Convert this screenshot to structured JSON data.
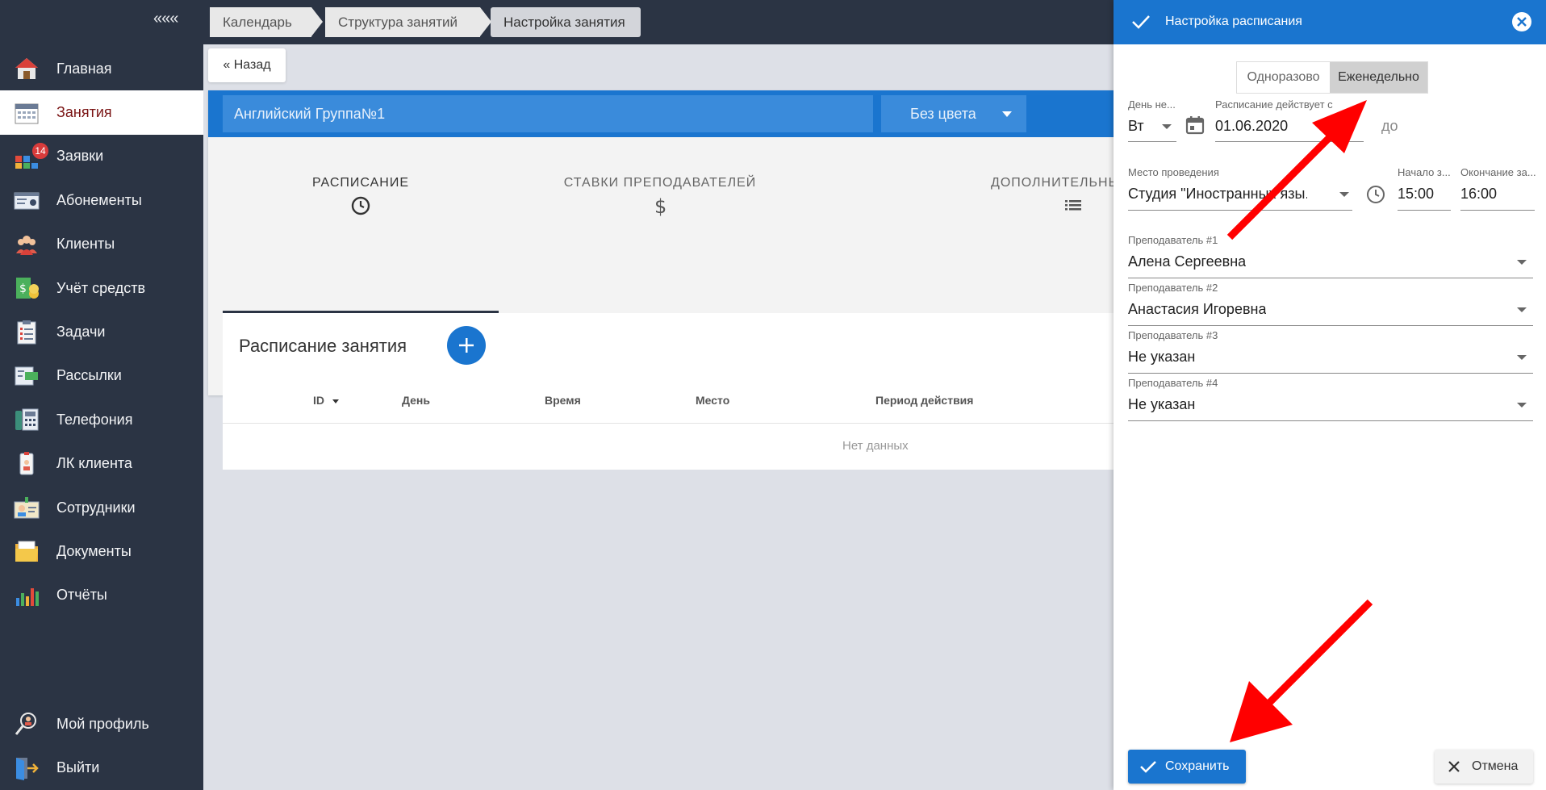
{
  "sidebar": {
    "collapse_label": "«««",
    "items": [
      {
        "label": "Главная",
        "icon": "home-icon"
      },
      {
        "label": "Занятия",
        "icon": "calendar-icon"
      },
      {
        "label": "Заявки",
        "icon": "requests-icon",
        "badge": "14"
      },
      {
        "label": "Абонементы",
        "icon": "subscription-icon"
      },
      {
        "label": "Клиенты",
        "icon": "clients-icon"
      },
      {
        "label": "Учёт средств",
        "icon": "money-icon"
      },
      {
        "label": "Задачи",
        "icon": "tasks-icon"
      },
      {
        "label": "Рассылки",
        "icon": "mailing-icon"
      },
      {
        "label": "Телефония",
        "icon": "phone-icon"
      },
      {
        "label": "ЛК клиента",
        "icon": "client-account-icon"
      },
      {
        "label": "Сотрудники",
        "icon": "staff-icon"
      },
      {
        "label": "Документы",
        "icon": "documents-icon"
      },
      {
        "label": "Отчёты",
        "icon": "reports-icon"
      }
    ],
    "bottom_items": [
      {
        "label": "Мой профиль",
        "icon": "profile-icon"
      },
      {
        "label": "Выйти",
        "icon": "logout-icon"
      }
    ]
  },
  "breadcrumbs": [
    "Календарь",
    "Структура занятий",
    "Настройка занятия"
  ],
  "main": {
    "back_label": "« Назад",
    "group_name": "Английский Группа№1",
    "color_select": "Без цвета",
    "tabs": [
      {
        "label": "РАСПИСАНИЕ",
        "icon": "clock-icon"
      },
      {
        "label": "СТАВКИ ПРЕПОДАВАТЕЛЕЙ",
        "icon": "dollar-icon"
      },
      {
        "label": "ДОПОЛНИТЕЛЬНЫЕ УС...",
        "icon": "list-icon"
      }
    ],
    "section_title": "Расписание занятия",
    "columns": [
      "ID",
      "День",
      "Время",
      "Место",
      "Период действия"
    ],
    "empty_text": "Нет данных"
  },
  "panel": {
    "title": "Настройка расписания",
    "toggle": [
      "Одноразово",
      "Еженедельно"
    ],
    "day_label": "День не...",
    "day_value": "Вт",
    "schedule_from_label": "Расписание действует с",
    "schedule_from_value": "01.06.2020",
    "schedule_to_placeholder": "до",
    "place_label": "Место проведения",
    "place_value": "Студия \"Иностранных язы...",
    "start_label": "Начало з...",
    "start_value": "15:00",
    "end_label": "Окончание за...",
    "end_value": "16:00",
    "teachers": [
      {
        "label": "Преподаватель #1",
        "value": "Алена Сергеевна"
      },
      {
        "label": "Преподаватель #2",
        "value": "Анастасия Игоревна"
      },
      {
        "label": "Преподаватель #3",
        "value": "Не указан"
      },
      {
        "label": "Преподаватель #4",
        "value": "Не указан"
      }
    ],
    "save_label": "Сохранить",
    "cancel_label": "Отмена"
  },
  "colors": {
    "accent": "#1a75cf",
    "sidebar": "#2b3444",
    "annotation": "#ff0000"
  }
}
